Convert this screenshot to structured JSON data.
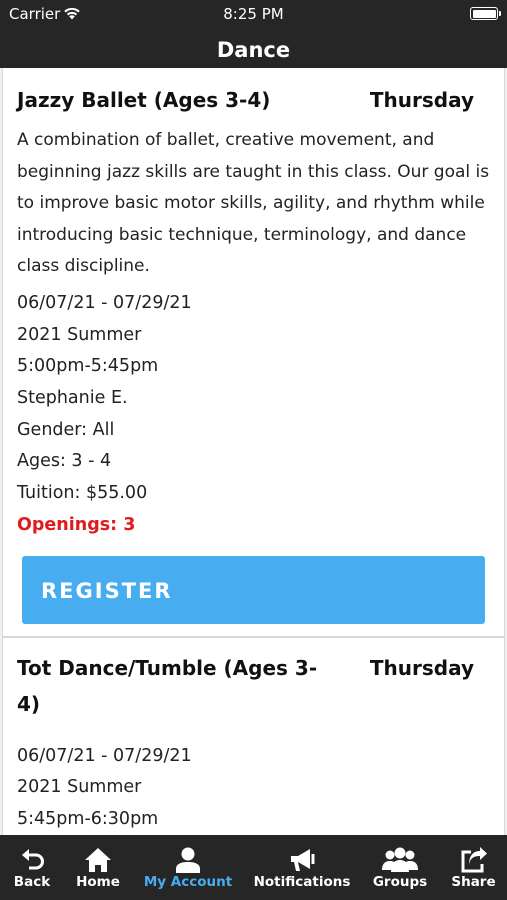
{
  "status": {
    "carrier": "Carrier",
    "time": "8:25 PM"
  },
  "nav": {
    "title": "Dance"
  },
  "classes": [
    {
      "title": "Jazzy Ballet (Ages 3-4)",
      "day": "Thursday",
      "description": "A combination of ballet, creative movement, and beginning jazz skills are taught in this class. Our goal is to improve basic motor skills, agility, and rhythm while introducing basic technique, terminology, and dance class discipline.",
      "dates": "06/07/21 - 07/29/21",
      "session": "2021 Summer",
      "time": "5:00pm-5:45pm",
      "instructor": "Stephanie E.",
      "gender": "Gender: All",
      "ages": "Ages: 3 - 4",
      "tuition": "Tuition: $55.00",
      "openings": "Openings: 3",
      "register_label": "REGISTER"
    },
    {
      "title": "Tot Dance/Tumble (Ages 3-4)",
      "day": "Thursday",
      "dates": "06/07/21 - 07/29/21",
      "session": "2021 Summer",
      "time": "5:45pm-6:30pm"
    }
  ],
  "tabs": [
    {
      "label": "Back",
      "icon": "back-arrow-icon"
    },
    {
      "label": "Home",
      "icon": "home-icon"
    },
    {
      "label": "My Account",
      "icon": "person-icon",
      "active": true
    },
    {
      "label": "Notifications",
      "icon": "megaphone-icon"
    },
    {
      "label": "Groups",
      "icon": "group-icon"
    },
    {
      "label": "Share",
      "icon": "share-icon"
    }
  ],
  "colors": {
    "bar": "#262626",
    "accent": "#47adf0",
    "openings": "#e01b1b"
  }
}
